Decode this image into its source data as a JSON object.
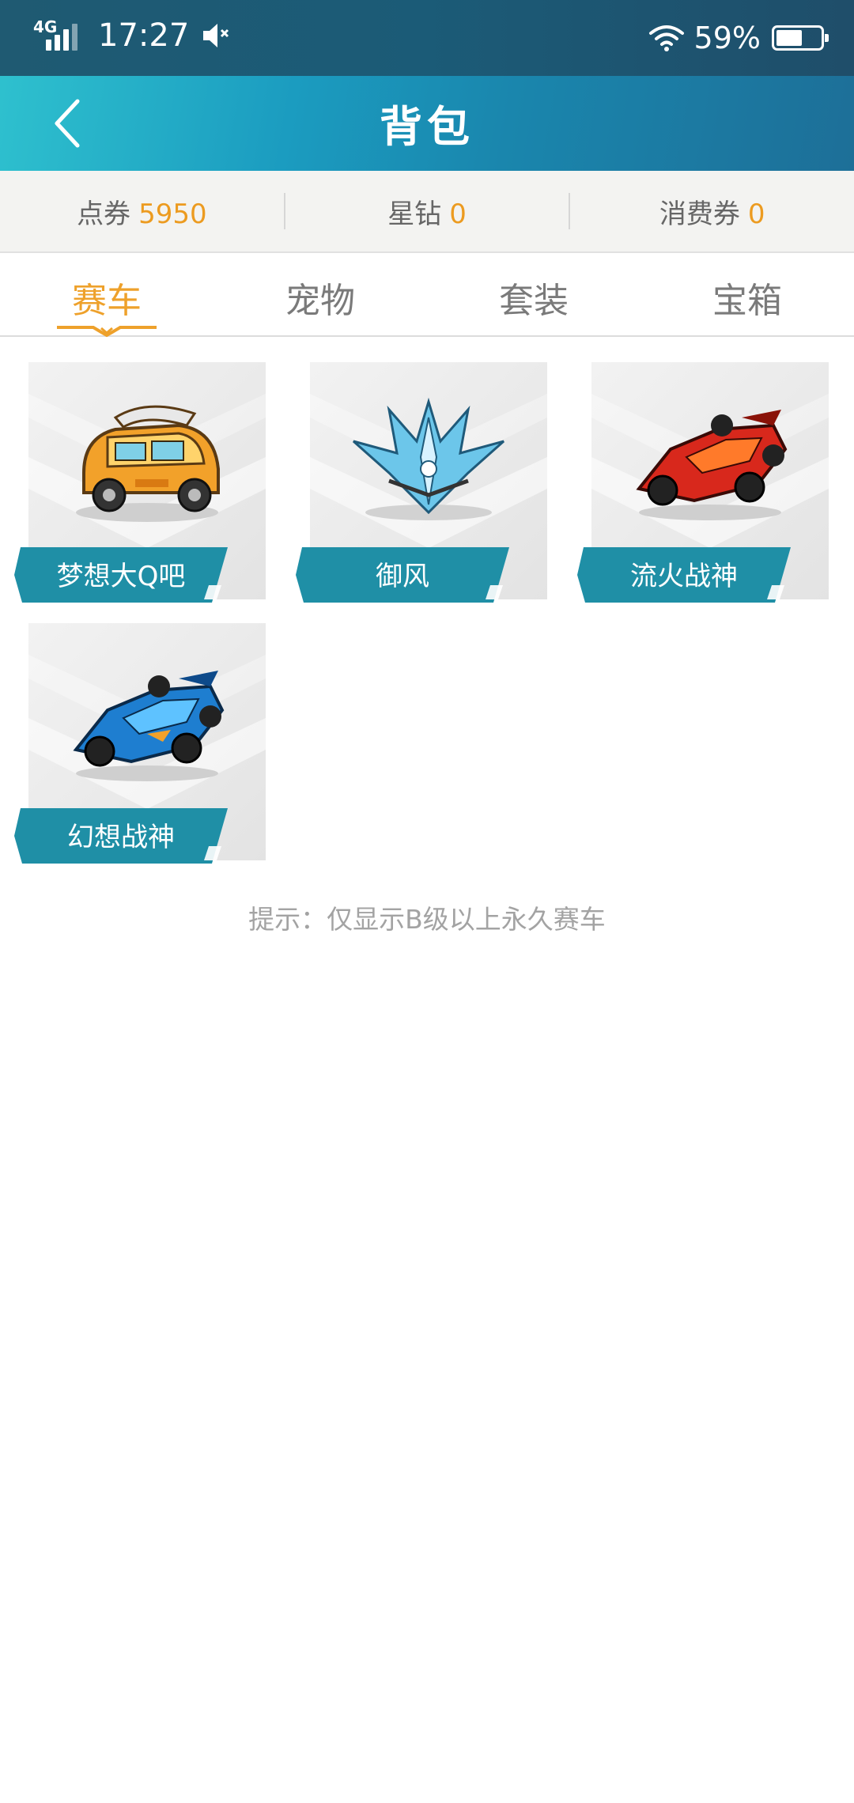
{
  "status_bar": {
    "network": "4G",
    "time": "17:27",
    "battery_pct": "59%",
    "battery_level": 0.59
  },
  "header": {
    "title": "背包"
  },
  "currency": [
    {
      "label": "点券",
      "value": "5950"
    },
    {
      "label": "星钻",
      "value": "0"
    },
    {
      "label": "消费券",
      "value": "0"
    }
  ],
  "tabs": [
    {
      "label": "赛车",
      "active": true
    },
    {
      "label": "宠物",
      "active": false
    },
    {
      "label": "套装",
      "active": false
    },
    {
      "label": "宝箱",
      "active": false
    }
  ],
  "items": [
    {
      "name": "梦想大Q吧",
      "icon": "yellow-kart-icon"
    },
    {
      "name": "御风",
      "icon": "crystal-wing-kart-icon"
    },
    {
      "name": "流火战神",
      "icon": "red-racer-kart-icon"
    },
    {
      "name": "幻想战神",
      "icon": "blue-racer-kart-icon"
    }
  ],
  "hint": "提示：仅显示B级以上永久赛车",
  "colors": {
    "accent": "#eea12b",
    "label_bg": "#1f8fa6",
    "header_gradient_start": "#2fc2cf",
    "header_gradient_end": "#1d6f98"
  }
}
